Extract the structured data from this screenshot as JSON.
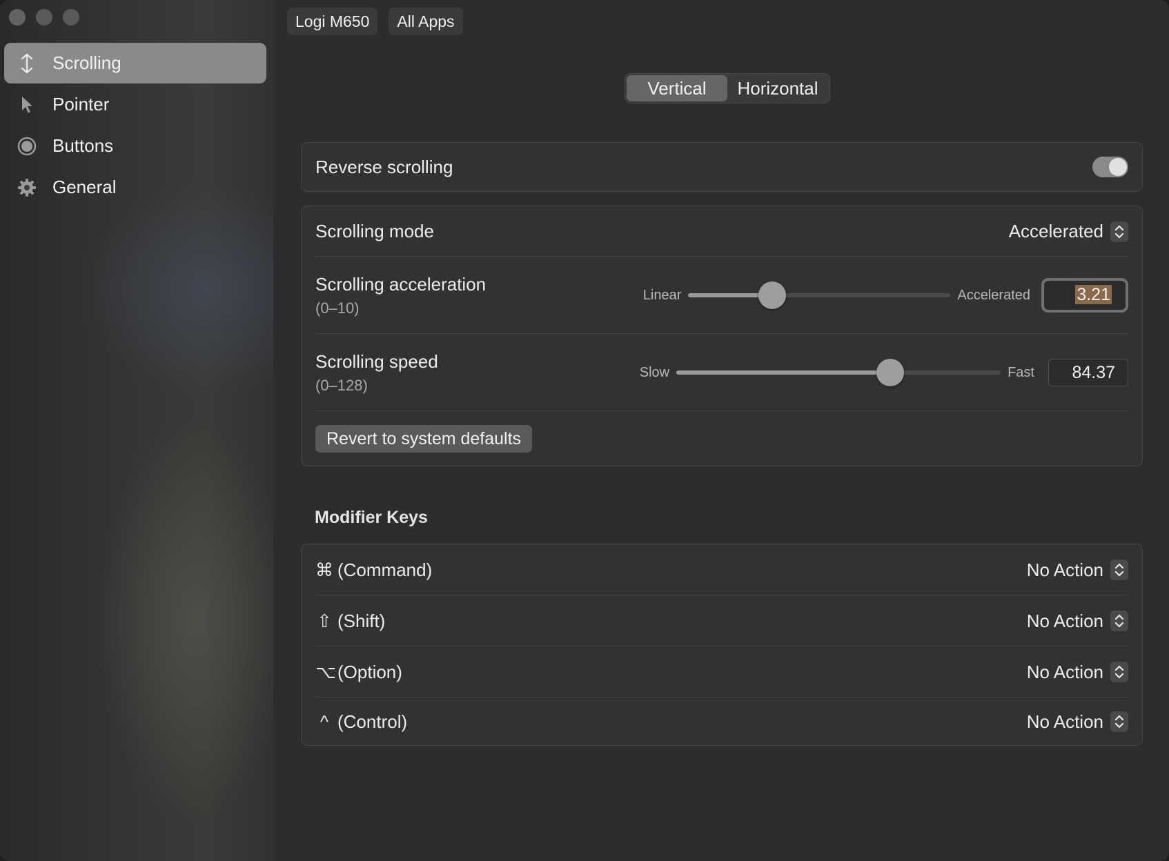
{
  "window": {
    "title": ""
  },
  "sidebar": {
    "items": [
      {
        "label": "Scrolling",
        "icon": "vertical-arrows-icon",
        "active": true
      },
      {
        "label": "Pointer",
        "icon": "cursor-arrow-icon",
        "active": false
      },
      {
        "label": "Buttons",
        "icon": "circle-button-icon",
        "active": false
      },
      {
        "label": "General",
        "icon": "gear-icon",
        "active": false
      }
    ]
  },
  "device_tabs": [
    "Logi M650",
    "All Apps"
  ],
  "direction_tabs": {
    "items": [
      "Vertical",
      "Horizontal"
    ],
    "selected": "Vertical"
  },
  "reverse_scrolling": {
    "label": "Reverse scrolling",
    "enabled": true
  },
  "scrolling": {
    "mode": {
      "label": "Scrolling mode",
      "value": "Accelerated"
    },
    "acceleration": {
      "label": "Scrolling acceleration",
      "range": "(0–10)",
      "min_label": "Linear",
      "max_label": "Accelerated",
      "min": 0,
      "max": 10,
      "value": "3.21"
    },
    "speed": {
      "label": "Scrolling speed",
      "range": "(0–128)",
      "min_label": "Slow",
      "max_label": "Fast",
      "min": 0,
      "max": 128,
      "value": "84.37"
    },
    "revert_label": "Revert to system defaults"
  },
  "modifier_keys": {
    "title": "Modifier Keys",
    "rows": [
      {
        "symbol": "⌘",
        "label": "(Command)",
        "value": "No Action"
      },
      {
        "symbol": "⇧",
        "label": "(Shift)",
        "value": "No Action"
      },
      {
        "symbol": "⌥",
        "label": "(Option)",
        "value": "No Action"
      },
      {
        "symbol": "^",
        "label": "(Control)",
        "value": "No Action"
      }
    ]
  },
  "colors": {
    "accent_selection": "#8a6a4a",
    "sidebar_active": "#8a8a8a"
  }
}
